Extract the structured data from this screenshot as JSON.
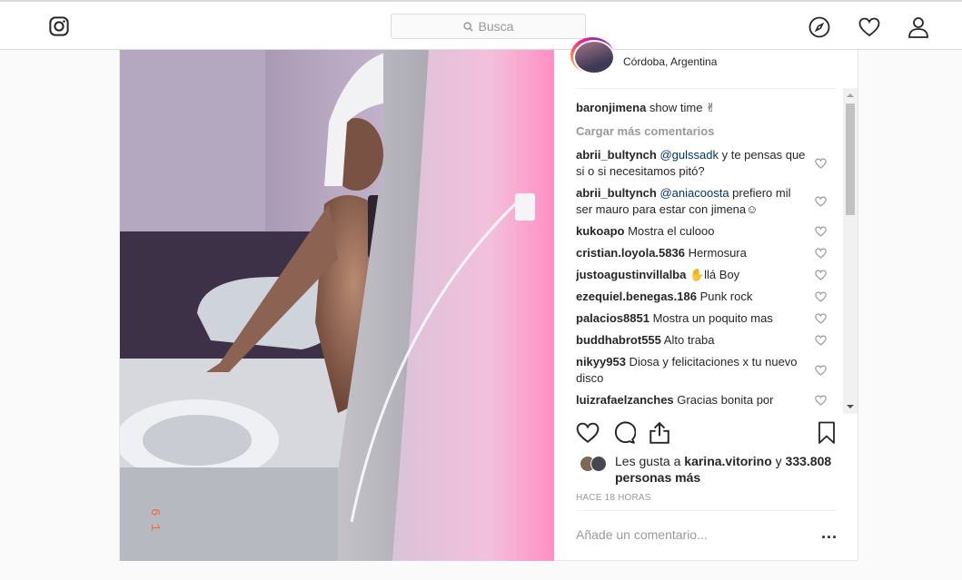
{
  "search": {
    "placeholder": "Busca"
  },
  "post": {
    "location": "Córdoba, Argentina",
    "caption": {
      "user": "baronjimena",
      "text": " show time ✌"
    },
    "load_more": "Cargar más comentarios",
    "comments": [
      {
        "user": "abrii_bultynch",
        "mention": "@gulssadk",
        "text": " y te pensas que si o si necesitamos pitó?"
      },
      {
        "user": "abrii_bultynch",
        "mention": "@aniacoosta",
        "text": " prefiero mil ser mauro para estar con jimena☺"
      },
      {
        "user": "kukoapo",
        "mention": "",
        "text": " Mostra el culooo"
      },
      {
        "user": "cristian.loyola.5836",
        "mention": "",
        "text": " Hermosura"
      },
      {
        "user": "justoagustinvillalba",
        "mention": "",
        "text": " ✋llá Boy"
      },
      {
        "user": "ezequiel.benegas.186",
        "mention": "",
        "text": " Punk rock"
      },
      {
        "user": "palacios8851",
        "mention": "",
        "text": " Mostra un poquito mas"
      },
      {
        "user": "buddhabrot555",
        "mention": "",
        "text": " Alto traba"
      },
      {
        "user": "nikyy953",
        "mention": "",
        "text": " Diosa y felicitaciones x tu nuevo disco"
      },
      {
        "user": "luizrafaelzanches",
        "mention": "",
        "text": " Gracias bonita por"
      }
    ],
    "likes": {
      "prefix": "Les gusta a ",
      "user": "karina.vitorino",
      "middle": " y ",
      "count": "333.808 personas más"
    },
    "time": "HACE 18 HORAS",
    "add_comment_placeholder": "Añade un comentario...",
    "more_label": "..."
  },
  "colors": {
    "accent": "#003569",
    "muted": "#999999",
    "border": "#dbdbdb"
  }
}
